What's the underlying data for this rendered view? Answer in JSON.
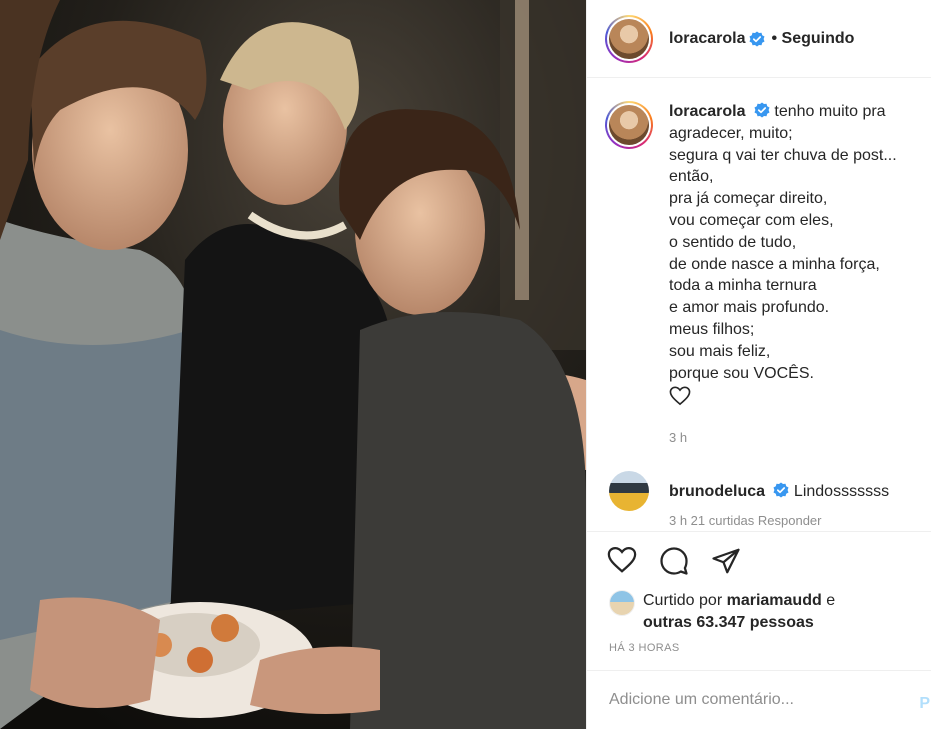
{
  "post": {
    "username": "loracarola",
    "follow_status": "• Seguindo",
    "verified_icon": "verified-badge-icon",
    "accent_color": "#3897f0"
  },
  "caption": {
    "username": "loracarola",
    "first_line": "tenho muito pra",
    "lines": [
      "agradecer, muito;",
      "segura q vai ter chuva de post...",
      "então,",
      "pra já começar direito,",
      "vou começar com eles,",
      "o sentido de tudo,",
      "de onde nasce a minha força,",
      "toda a minha ternura",
      "e amor mais profundo.",
      "meus filhos;",
      "sou mais feliz,",
      "porque sou VOCÊS."
    ],
    "emoji_icon": "heart-outline-icon",
    "time": "3 h"
  },
  "comment": {
    "username": "brunodeluca",
    "text": "Lindosssssss",
    "meta": "3 h 21 curtidas Responder"
  },
  "likes": {
    "prefix": "Curtido por",
    "user": "mariamaudd",
    "conj": "e",
    "others": "outras 63.347 pessoas"
  },
  "ago": "HÁ 3 HORAS",
  "add_comment": {
    "placeholder": "Adicione um comentário...",
    "post_label": "P"
  }
}
